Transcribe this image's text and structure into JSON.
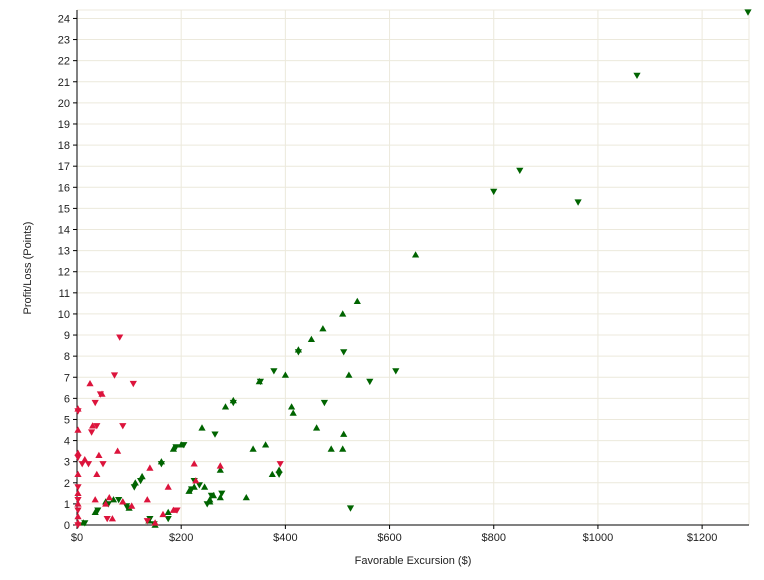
{
  "chart_data": {
    "type": "scatter",
    "xlabel": "Favorable Excursion ($)",
    "ylabel": "Profit/Loss (Points)",
    "xlim": [
      0,
      1290
    ],
    "ylim": [
      0,
      24.4
    ],
    "grid": true,
    "x_ticks": [
      0,
      200,
      400,
      600,
      800,
      1000,
      1200
    ],
    "x_tick_labels": [
      "$0",
      "$200",
      "$400",
      "$600",
      "$800",
      "$1000",
      "$1200"
    ],
    "y_ticks": [
      0,
      1,
      2,
      3,
      4,
      5,
      6,
      7,
      8,
      9,
      10,
      11,
      12,
      13,
      14,
      15,
      16,
      17,
      18,
      19,
      20,
      21,
      22,
      23,
      24
    ],
    "y_tick_labels": [
      "0",
      "1",
      "2",
      "3",
      "4",
      "5",
      "6",
      "7",
      "8",
      "9",
      "10",
      "11",
      "12",
      "13",
      "14",
      "15",
      "16",
      "17",
      "18",
      "19",
      "20",
      "21",
      "22",
      "23",
      "24"
    ],
    "colors": {
      "green": "#006400",
      "red": "#dc143c"
    },
    "series": [
      {
        "color": "green",
        "marker": "triangle-up",
        "points": [
          [
            12,
            0.1
          ],
          [
            35,
            0.6
          ],
          [
            55,
            1.1
          ],
          [
            70,
            1.2
          ],
          [
            88,
            1.1
          ],
          [
            100,
            0.8
          ],
          [
            112,
            2.0
          ],
          [
            125,
            2.3
          ],
          [
            138,
            0.2
          ],
          [
            150,
            0.0
          ],
          [
            162,
            3.0
          ],
          [
            175,
            0.6
          ],
          [
            185,
            3.6
          ],
          [
            200,
            3.8
          ],
          [
            215,
            1.6
          ],
          [
            225,
            1.8
          ],
          [
            240,
            4.6
          ],
          [
            245,
            1.8
          ],
          [
            255,
            1.1
          ],
          [
            262,
            1.4
          ],
          [
            275,
            2.6
          ],
          [
            285,
            5.6
          ],
          [
            300,
            5.9
          ],
          [
            325,
            1.3
          ],
          [
            338,
            3.6
          ],
          [
            350,
            6.8
          ],
          [
            362,
            3.8
          ],
          [
            375,
            2.4
          ],
          [
            388,
            2.6
          ],
          [
            400,
            7.1
          ],
          [
            412,
            5.6
          ],
          [
            425,
            8.3
          ],
          [
            450,
            8.8
          ],
          [
            460,
            4.6
          ],
          [
            472,
            9.3
          ],
          [
            488,
            3.6
          ],
          [
            510,
            10.0
          ],
          [
            512,
            4.3
          ],
          [
            522,
            7.1
          ],
          [
            538,
            10.6
          ],
          [
            650,
            12.8
          ],
          [
            415,
            5.3
          ],
          [
            275,
            1.3
          ],
          [
            510,
            3.6
          ],
          [
            255,
            1.2
          ]
        ]
      },
      {
        "color": "green",
        "marker": "triangle-down",
        "points": [
          [
            15,
            0.1
          ],
          [
            40,
            0.7
          ],
          [
            60,
            1.0
          ],
          [
            80,
            1.2
          ],
          [
            95,
            0.9
          ],
          [
            110,
            1.8
          ],
          [
            122,
            2.1
          ],
          [
            140,
            0.3
          ],
          [
            148,
            0.05
          ],
          [
            162,
            2.9
          ],
          [
            175,
            0.3
          ],
          [
            190,
            3.7
          ],
          [
            205,
            3.8
          ],
          [
            220,
            1.7
          ],
          [
            235,
            1.9
          ],
          [
            250,
            1.0
          ],
          [
            265,
            4.3
          ],
          [
            278,
            1.5
          ],
          [
            300,
            5.8
          ],
          [
            352,
            6.8
          ],
          [
            378,
            7.3
          ],
          [
            388,
            2.4
          ],
          [
            425,
            8.2
          ],
          [
            475,
            5.8
          ],
          [
            512,
            8.2
          ],
          [
            525,
            0.8
          ],
          [
            562,
            6.8
          ],
          [
            612,
            7.3
          ],
          [
            800,
            15.8
          ],
          [
            850,
            16.8
          ],
          [
            962,
            15.3
          ],
          [
            1075,
            21.3
          ],
          [
            1290,
            24.3
          ],
          [
            225,
            2.1
          ],
          [
            258,
            1.4
          ]
        ]
      },
      {
        "color": "red",
        "marker": "triangle-up",
        "points": [
          [
            0,
            0.1
          ],
          [
            0,
            0.4
          ],
          [
            0,
            1.0
          ],
          [
            0,
            1.5
          ],
          [
            0,
            2.4
          ],
          [
            0,
            3.4
          ],
          [
            0,
            4.5
          ],
          [
            0,
            5.5
          ],
          [
            15,
            3.1
          ],
          [
            25,
            6.7
          ],
          [
            30,
            4.7
          ],
          [
            35,
            1.2
          ],
          [
            38,
            2.4
          ],
          [
            42,
            3.3
          ],
          [
            48,
            6.2
          ],
          [
            55,
            1.0
          ],
          [
            62,
            1.3
          ],
          [
            68,
            0.3
          ],
          [
            78,
            3.5
          ],
          [
            88,
            1.1
          ],
          [
            105,
            0.9
          ],
          [
            135,
            1.2
          ],
          [
            140,
            2.7
          ],
          [
            150,
            0.1
          ],
          [
            165,
            0.5
          ],
          [
            175,
            1.8
          ],
          [
            185,
            0.7
          ],
          [
            225,
            2.9
          ],
          [
            228,
            2.1
          ],
          [
            275,
            2.8
          ]
        ]
      },
      {
        "color": "red",
        "marker": "triangle-down",
        "points": [
          [
            0,
            0.0
          ],
          [
            0,
            0.7
          ],
          [
            0,
            1.2
          ],
          [
            0,
            1.8
          ],
          [
            0,
            3.2
          ],
          [
            0,
            5.4
          ],
          [
            10,
            2.9
          ],
          [
            22,
            2.9
          ],
          [
            28,
            4.4
          ],
          [
            35,
            5.8
          ],
          [
            38,
            4.7
          ],
          [
            45,
            6.2
          ],
          [
            50,
            2.9
          ],
          [
            58,
            0.3
          ],
          [
            72,
            7.1
          ],
          [
            82,
            8.9
          ],
          [
            88,
            4.7
          ],
          [
            108,
            6.7
          ],
          [
            135,
            0.2
          ],
          [
            192,
            0.7
          ],
          [
            390,
            2.9
          ]
        ]
      }
    ]
  }
}
